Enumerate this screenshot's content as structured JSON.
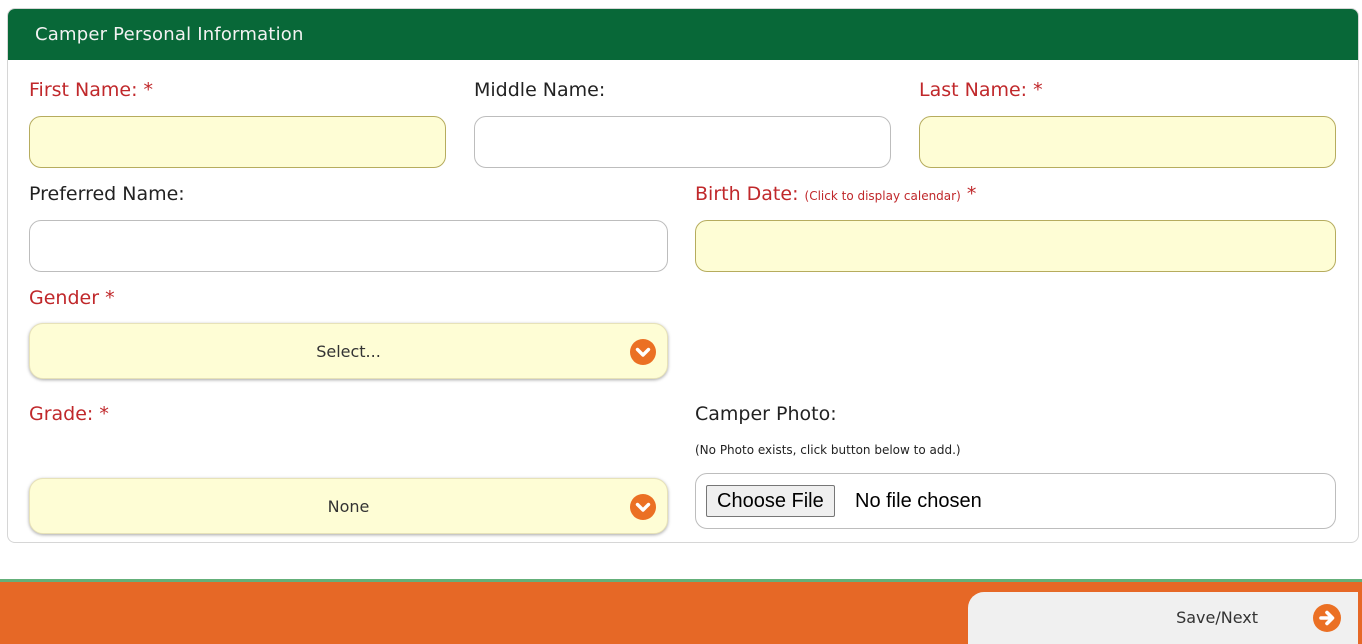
{
  "panel": {
    "title": "Camper Personal Information"
  },
  "fields": {
    "first_name": {
      "label": "First Name:",
      "required_mark": "*",
      "value": ""
    },
    "middle_name": {
      "label": "Middle Name:",
      "value": ""
    },
    "last_name": {
      "label": "Last Name:",
      "required_mark": "*",
      "value": ""
    },
    "preferred_name": {
      "label": "Preferred Name:",
      "value": ""
    },
    "birth_date": {
      "label": "Birth Date:",
      "hint": "(Click to display calendar)",
      "required_mark": "*",
      "value": ""
    },
    "gender": {
      "label": "Gender",
      "required_mark": "*",
      "selected": "Select..."
    },
    "grade": {
      "label": "Grade:",
      "required_mark": "*",
      "selected": "None"
    },
    "camper_photo": {
      "label": "Camper Photo:",
      "note": "(No Photo exists, click button below to add.)",
      "button_label": "Choose File",
      "status": "No file chosen"
    }
  },
  "footer": {
    "save_label": "Save/Next"
  },
  "icons": {
    "dropdown": "chevron-down-circle-icon",
    "next": "arrow-right-circle-icon"
  },
  "colors": {
    "header": "#086838",
    "required_label": "#c0282b",
    "required_fill": "#fefdd5",
    "accent": "#eb7024",
    "footer": "#e66826"
  }
}
